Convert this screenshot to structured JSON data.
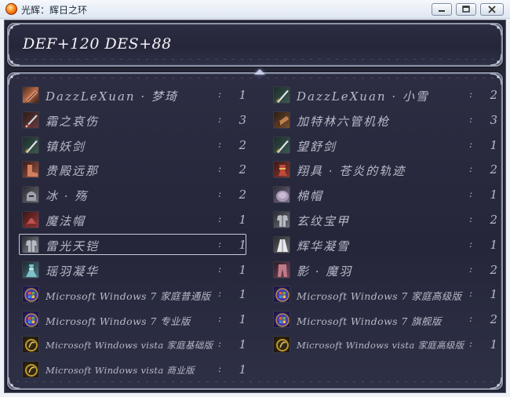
{
  "window": {
    "title": "光辉：辉日之环",
    "icons": {
      "app": "fire-orb-icon",
      "minimize": "minimize-icon",
      "maximize": "maximize-icon",
      "close": "close-icon"
    }
  },
  "stats": {
    "text": "DEF+120 DES+88"
  },
  "items": [
    {
      "name": "DazzLeXuan · 梦琦",
      "count": "1",
      "icon": "scroll-icon",
      "style": "ic-scroll",
      "size": ""
    },
    {
      "name": "DazzLeXuan · 小雪",
      "count": "2",
      "icon": "sword-icon",
      "style": "ic-sword",
      "size": ""
    },
    {
      "name": "霜之哀伤",
      "count": "3",
      "icon": "blade-icon",
      "style": "ic-blade-red",
      "size": ""
    },
    {
      "name": "加特林六管机枪",
      "count": "3",
      "icon": "gun-icon",
      "style": "ic-gun",
      "size": ""
    },
    {
      "name": "镇妖剑",
      "count": "2",
      "icon": "sword-icon",
      "style": "ic-sword",
      "size": ""
    },
    {
      "name": "望舒剑",
      "count": "1",
      "icon": "sword-icon",
      "style": "ic-sword",
      "size": ""
    },
    {
      "name": "贵殿远那",
      "count": "2",
      "icon": "boots-icon",
      "style": "ic-boots",
      "size": ""
    },
    {
      "name": "翔具 · 苍炎的轨迹",
      "count": "2",
      "icon": "track-icon",
      "style": "ic-track",
      "size": ""
    },
    {
      "name": "冰 · 殇",
      "count": "2",
      "icon": "helmet-icon",
      "style": "ic-helm",
      "size": ""
    },
    {
      "name": "棉帽",
      "count": "1",
      "icon": "cap-icon",
      "style": "ic-cap",
      "size": ""
    },
    {
      "name": "魔法帽",
      "count": "1",
      "icon": "hat-icon",
      "style": "ic-hat-red",
      "size": ""
    },
    {
      "name": "玄纹宝甲",
      "count": "2",
      "icon": "armor-icon",
      "style": "ic-armor",
      "size": ""
    },
    {
      "name": "雷光天铠",
      "count": "1",
      "icon": "armor-icon",
      "style": "ic-armor-white",
      "size": "",
      "selected": true
    },
    {
      "name": "辉华凝雪",
      "count": "1",
      "icon": "robe-icon",
      "style": "ic-robe",
      "size": ""
    },
    {
      "name": "瑶羽凝华",
      "count": "1",
      "icon": "skirt-icon",
      "style": "ic-skirt",
      "size": ""
    },
    {
      "name": "影 · 魔羽",
      "count": "2",
      "icon": "pants-icon",
      "style": "ic-pants",
      "size": ""
    },
    {
      "name": "Microsoft Windows 7 家庭普通版",
      "count": "1",
      "icon": "windows-orb-icon",
      "style": "ic-win",
      "size": "medium"
    },
    {
      "name": "Microsoft Windows 7 家庭高级版",
      "count": "1",
      "icon": "windows-orb-icon",
      "style": "ic-win",
      "size": "medium"
    },
    {
      "name": "Microsoft Windows 7 专业版",
      "count": "1",
      "icon": "windows-orb-icon",
      "style": "ic-win",
      "size": "medium"
    },
    {
      "name": "Microsoft Windows 7 旗舰版",
      "count": "2",
      "icon": "windows-orb-icon",
      "style": "ic-win",
      "size": "medium"
    },
    {
      "name": "Microsoft Windows vista 家庭基础版",
      "count": "1",
      "icon": "vista-orb-icon",
      "style": "ic-vista",
      "size": "small"
    },
    {
      "name": "Microsoft Windows vista 家庭高级版",
      "count": "1",
      "icon": "vista-orb-icon",
      "style": "ic-vista",
      "size": "small"
    },
    {
      "name": "Microsoft Windows vista 商业版",
      "count": "1",
      "icon": "vista-orb-icon",
      "style": "ic-vista",
      "size": "small"
    }
  ],
  "separator": ":"
}
